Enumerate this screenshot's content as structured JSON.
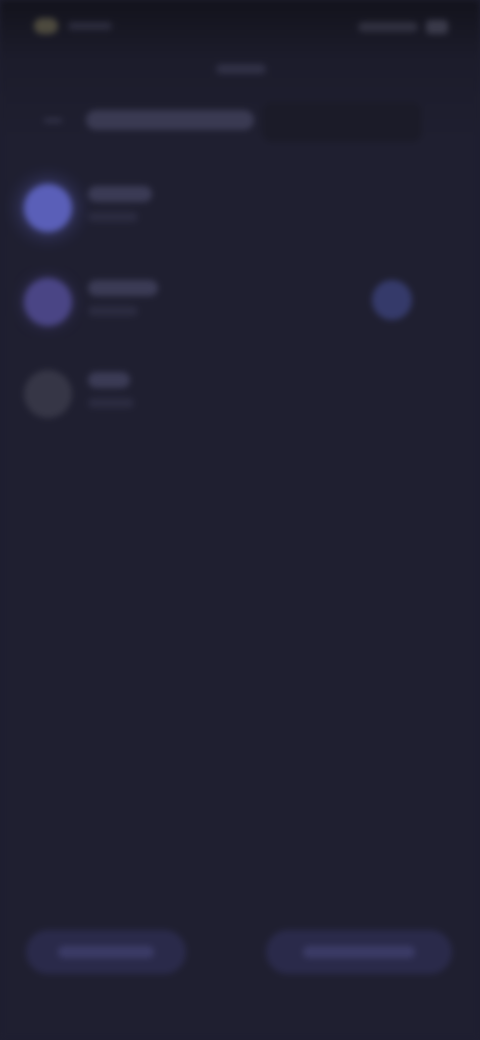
{
  "status_bar": {
    "time": "",
    "battery": ""
  },
  "header": {
    "caption": "",
    "title": ""
  },
  "list": {
    "items": [
      {
        "title": "",
        "subtitle": "",
        "avatar_color": "#5a5fb8"
      },
      {
        "title": "",
        "subtitle": "",
        "avatar_color": "#4a4585",
        "indicator_color": "#353a6a"
      },
      {
        "title": "",
        "subtitle": "",
        "avatar_color": "#363646"
      }
    ]
  },
  "bottom_bar": {
    "left_button_label": "",
    "right_button_label": ""
  },
  "theme": {
    "background": "#1f1f30",
    "accent": "#5a5fb8",
    "button": "#2a2a4a"
  }
}
